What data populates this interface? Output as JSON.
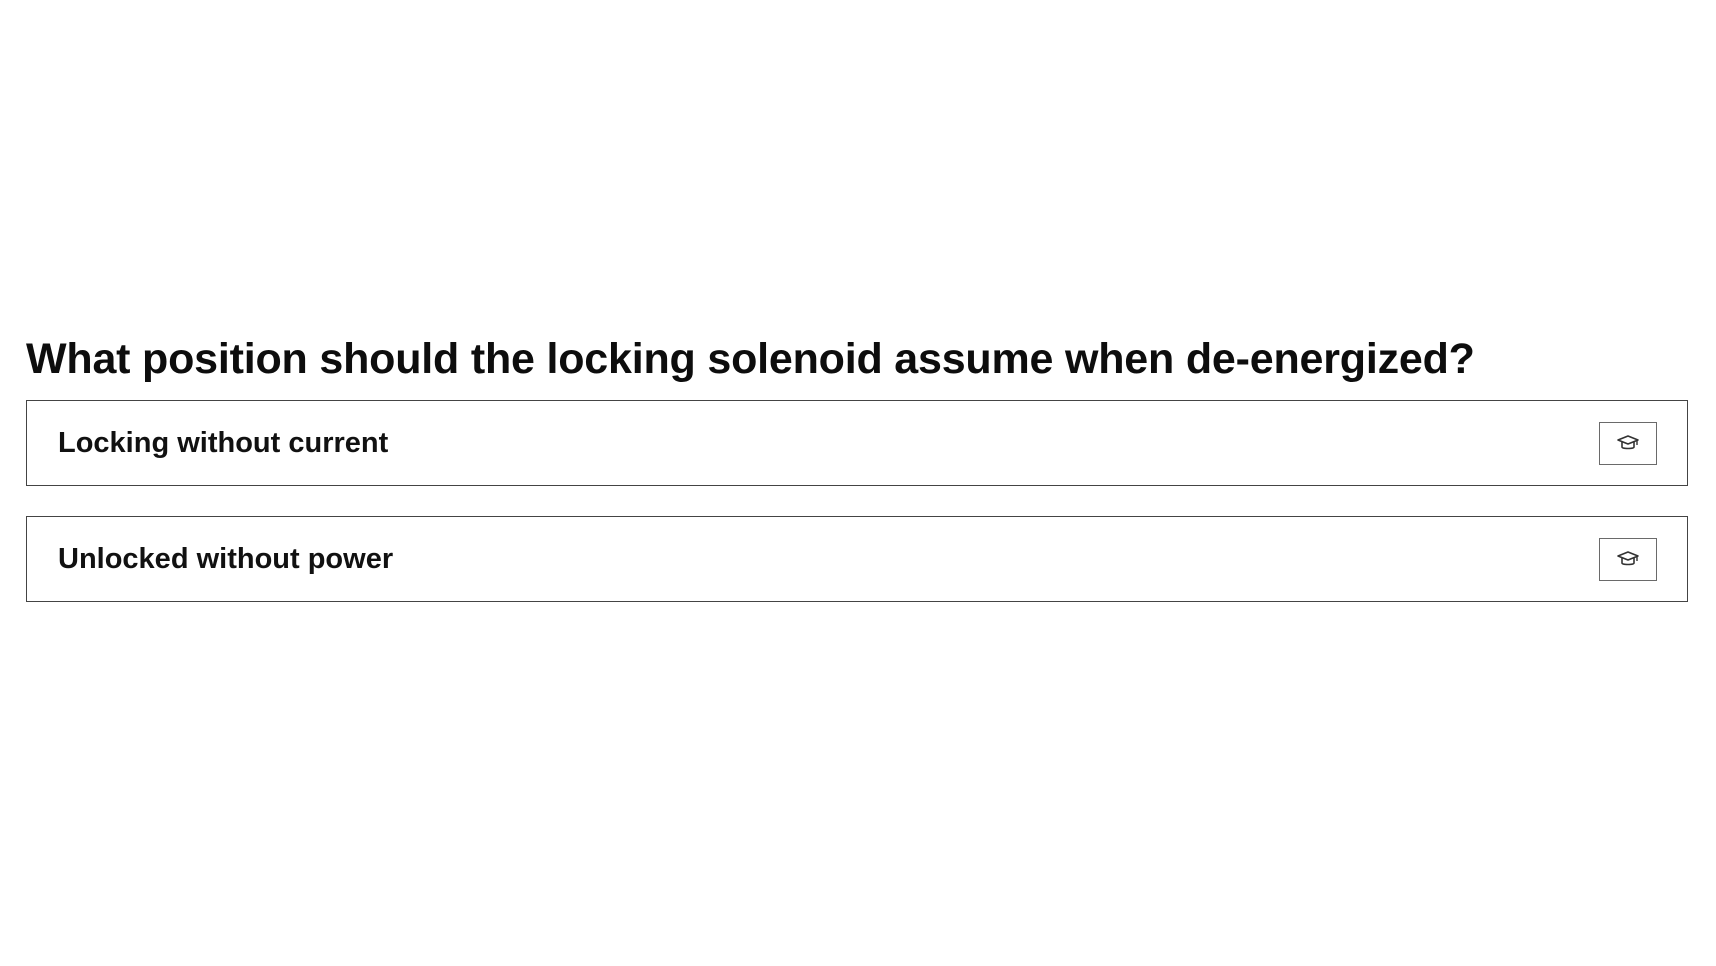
{
  "question": {
    "text": "What position should the locking solenoid assume when de-energized?"
  },
  "answers": [
    {
      "label": "Locking without current",
      "icon": "graduation-cap-icon"
    },
    {
      "label": "Unlocked without power",
      "icon": "graduation-cap-icon"
    }
  ]
}
